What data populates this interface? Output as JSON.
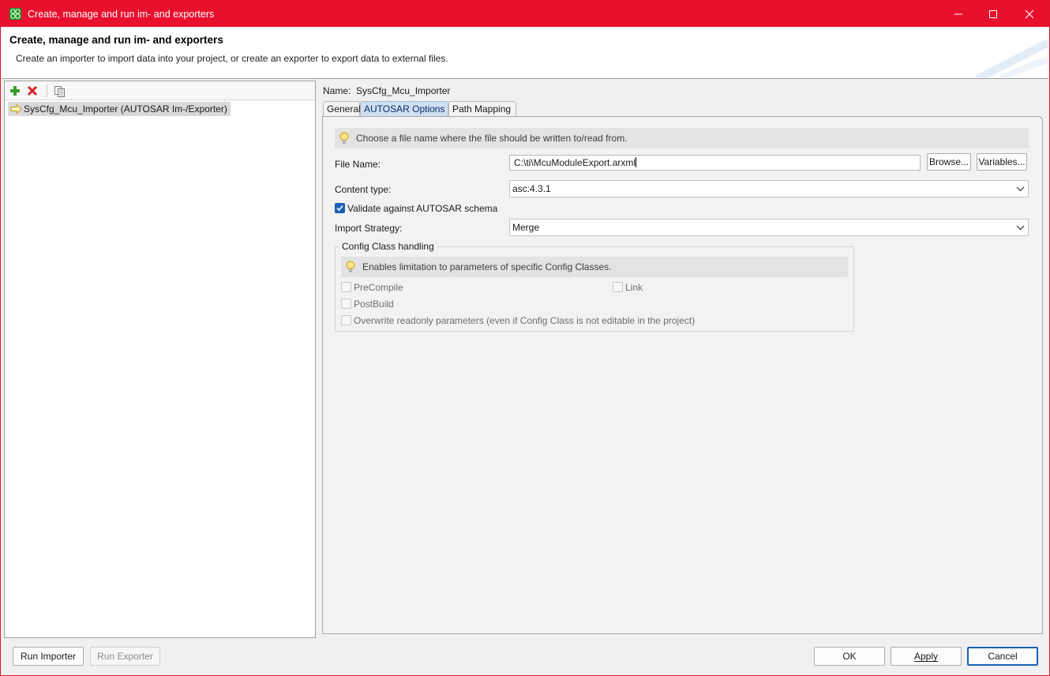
{
  "window": {
    "title": "Create, manage and run im- and exporters",
    "accent_color": "#e8112d"
  },
  "header": {
    "title": "Create, manage and run im- and exporters",
    "description": "Create an importer to import data into your project, or create an exporter to export data to external files."
  },
  "left_panel": {
    "toolbar": {
      "add_icon": "plus-icon",
      "delete_icon": "delete-x-icon",
      "copy_icon": "copy-icon"
    },
    "items": [
      {
        "label": "SysCfg_Mcu_Importer (AUTOSAR Im-/Exporter)",
        "icon": "arrow-right-icon",
        "selected": true
      }
    ]
  },
  "details": {
    "name_label": "Name:",
    "name_value": "SysCfg_Mcu_Importer",
    "tabs": [
      {
        "label": "General",
        "active": false
      },
      {
        "label": "AUTOSAR Options",
        "active": true
      },
      {
        "label": "Path Mapping",
        "active": false
      }
    ],
    "hint_file": "Choose a file name where the file should be written to/read from.",
    "file_name_label": "File Name:",
    "file_name_value": "C:\\ti\\McuModuleExport.arxml",
    "browse_label": "Browse...",
    "variables_label": "Variables...",
    "content_type_label": "Content type:",
    "content_type_value": "asc:4.3.1",
    "validate_label": "Validate against AUTOSAR schema",
    "validate_checked": true,
    "import_strategy_label": "Import Strategy:",
    "import_strategy_value": "Merge",
    "config_class": {
      "title": "Config Class handling",
      "hint": "Enables limitation to parameters of specific Config Classes.",
      "precompile_label": "PreCompile",
      "link_label": "Link",
      "postbuild_label": "PostBuild",
      "overwrite_label": "Overwrite readonly parameters (even if Config Class is not editable in the project)"
    }
  },
  "footer": {
    "run_importer_label": "Run Importer",
    "run_exporter_label": "Run Exporter",
    "ok_label": "OK",
    "apply_label": "Apply",
    "cancel_label": "Cancel"
  }
}
